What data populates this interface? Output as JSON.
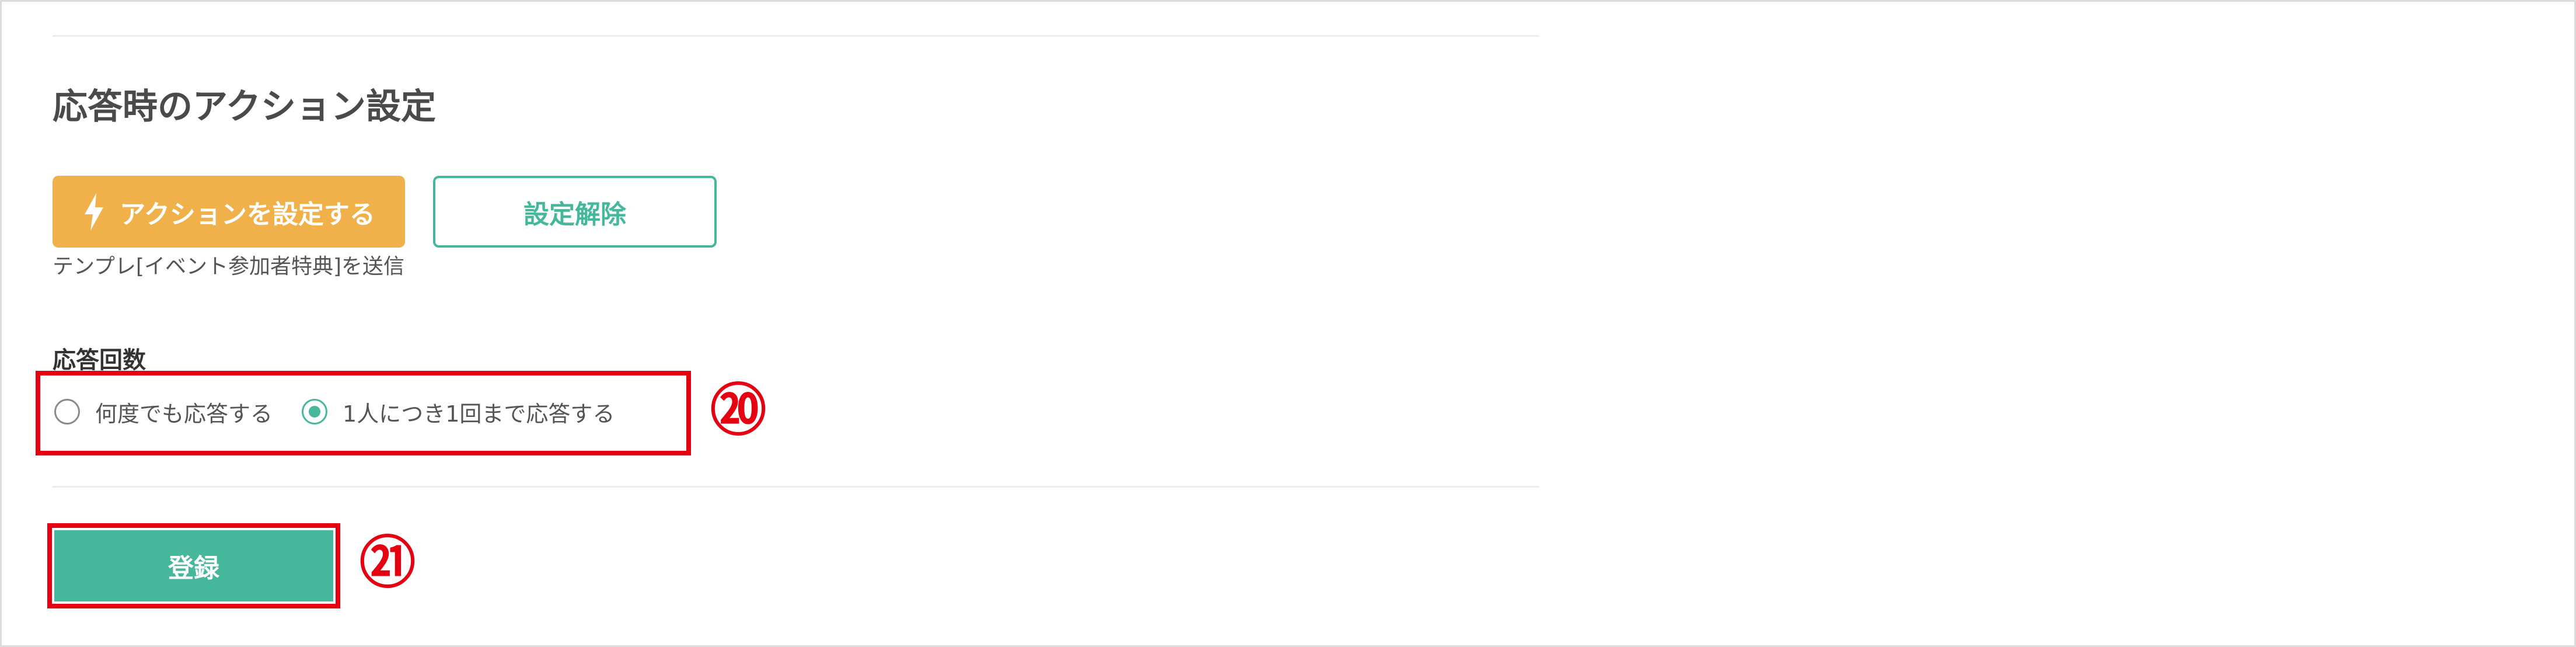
{
  "section": {
    "title": "応答時のアクション設定"
  },
  "action": {
    "set_button_label": "アクションを設定する",
    "release_button_label": "設定解除",
    "caption": "テンプレ[イベント参加者特典]を送信"
  },
  "response_count": {
    "label": "応答回数",
    "options": [
      {
        "label": "何度でも応答する",
        "checked": false
      },
      {
        "label": "1人につき1回まで応答する",
        "checked": true
      }
    ]
  },
  "submit": {
    "label": "登録"
  },
  "annotations": {
    "marker_radios": "⑳",
    "marker_submit": "㉑"
  },
  "colors": {
    "accent_green": "#45b89c",
    "action_orange": "#f0b14a",
    "highlight_red": "#e50012"
  },
  "icons": {
    "action_button_icon": "lightning-bolt-icon"
  }
}
